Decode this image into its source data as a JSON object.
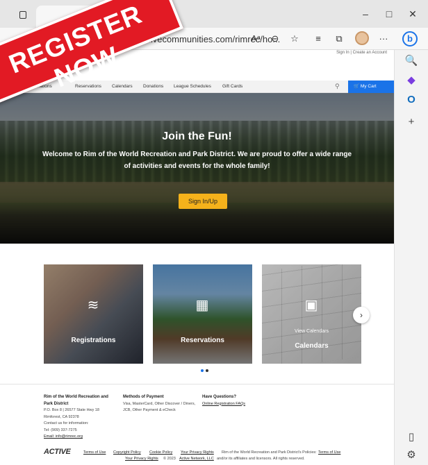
{
  "browser": {
    "url": "...ivecommunities.com/rimrec/ho...",
    "new_tab_glyph": "+",
    "window_controls": {
      "minimize": "–",
      "maximize": "□",
      "close": "✕"
    },
    "toolbar_icons": [
      "read-aloud-icon",
      "zoom-icon",
      "favorite-icon",
      "favorites-list-icon",
      "collections-icon",
      "profile-avatar",
      "more-icon",
      "bing-icon"
    ],
    "toolbar_glyphs": {
      "read_aloud": "Aᵃ",
      "zoom": "⊖",
      "favorite": "☆",
      "favorites_list": "≡",
      "collections": "⧉",
      "more": "···",
      "bing": "b"
    },
    "sidebar_icons": [
      "search-icon",
      "shopping-icon",
      "outlook-icon",
      "add-icon",
      "panel-icon",
      "settings-icon"
    ],
    "sidebar_glyphs": {
      "search": "🔍",
      "shopping": "◆",
      "outlook": "O",
      "add": "+",
      "panel": "▯",
      "settings": "⚙"
    }
  },
  "banner": {
    "text": "REGISTER NOW",
    "color": "#e21a24"
  },
  "page": {
    "top_links": "Sign In  |  Create an Account",
    "nav": {
      "items": [
        "...ations",
        "Reservations",
        "Calendars",
        "Donations",
        "League Schedules",
        "Gift Cards"
      ],
      "search_glyph": "⚲",
      "cart_label": "🛒 My Cart",
      "cart_color": "#1a73e8"
    },
    "hero": {
      "title": "Join the Fun!",
      "text": "Welcome to Rim of the World Recreation and Park District. We are proud to offer a wide range of activities and events for the whole family!",
      "button": "Sign In/Up",
      "button_color": "#f5b21b"
    },
    "cards": [
      {
        "label": "Registrations",
        "icon": "swim-icon",
        "glyph": "≋"
      },
      {
        "label": "Reservations",
        "icon": "building-icon",
        "glyph": "▦"
      },
      {
        "label": "Calendars",
        "sublabel": "View Calendars",
        "icon": "calendar-icon",
        "glyph": "▣"
      }
    ],
    "next_glyph": "›",
    "footer": {
      "org": {
        "name": "Rim of the World Recreation and Park District",
        "address1": "P.O. Box 8 | 26577 State Hwy 18",
        "address2": "Rimforest, CA 92378",
        "contact": "Contact us for information:",
        "tel": "Tel: (909) 337-7275",
        "email": "Email: info@rimrec.org"
      },
      "payment": {
        "title": "Methods of Payment",
        "line1": "Visa, MasterCard, Other Discover / Diners,",
        "line2": "JCB, Other Payment & eCheck"
      },
      "questions": {
        "title": "Have Questions?",
        "link": "Online Registration FAQs"
      },
      "bottom": {
        "logo": "ACTIVE",
        "terms": "Terms of Use",
        "copyright": "Copyright Policy",
        "cookie": "Cookie Policy",
        "privacy": "Your Privacy Rights",
        "policies_prefix": "Rim of the World Recreation and Park District's Policies:",
        "policies_terms": "Terms of Use",
        "policies_privacy": "Your Privacy Rights",
        "legal_prefix": "© 2023",
        "legal_link": "Active Network, LLC",
        "legal_suffix": "and/or its affiliates and licensors. All rights reserved."
      }
    }
  }
}
